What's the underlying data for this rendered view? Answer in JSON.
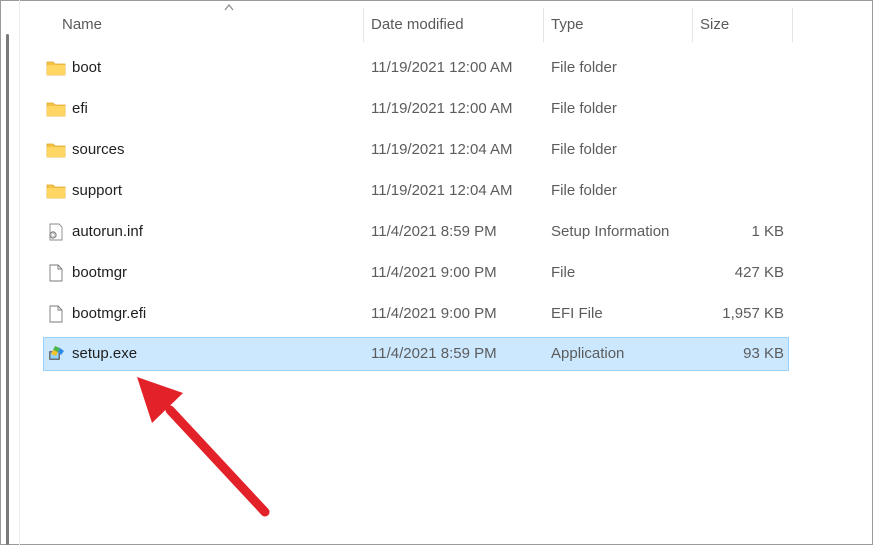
{
  "columns": {
    "name": "Name",
    "date": "Date modified",
    "type": "Type",
    "size": "Size"
  },
  "files": [
    {
      "name": "boot",
      "date": "11/19/2021 12:00 AM",
      "type": "File folder",
      "size": "",
      "icon": "folder-icon"
    },
    {
      "name": "efi",
      "date": "11/19/2021 12:00 AM",
      "type": "File folder",
      "size": "",
      "icon": "folder-icon"
    },
    {
      "name": "sources",
      "date": "11/19/2021 12:04 AM",
      "type": "File folder",
      "size": "",
      "icon": "folder-icon"
    },
    {
      "name": "support",
      "date": "11/19/2021 12:04 AM",
      "type": "File folder",
      "size": "",
      "icon": "folder-icon"
    },
    {
      "name": "autorun.inf",
      "date": "11/4/2021 8:59 PM",
      "type": "Setup Information",
      "size": "1 KB",
      "icon": "setup-info-icon"
    },
    {
      "name": "bootmgr",
      "date": "11/4/2021 9:00 PM",
      "type": "File",
      "size": "427 KB",
      "icon": "file-icon"
    },
    {
      "name": "bootmgr.efi",
      "date": "11/4/2021 9:00 PM",
      "type": "EFI File",
      "size": "1,957 KB",
      "icon": "file-icon"
    },
    {
      "name": "setup.exe",
      "date": "11/4/2021 8:59 PM",
      "type": "Application",
      "size": "93 KB",
      "icon": "application-icon"
    }
  ],
  "selected_file": "setup.exe",
  "colors": {
    "selection_bg": "#cce8ff",
    "selection_border": "#99d1ff",
    "folder": "#f6c244",
    "annotation_arrow": "#e32129"
  }
}
